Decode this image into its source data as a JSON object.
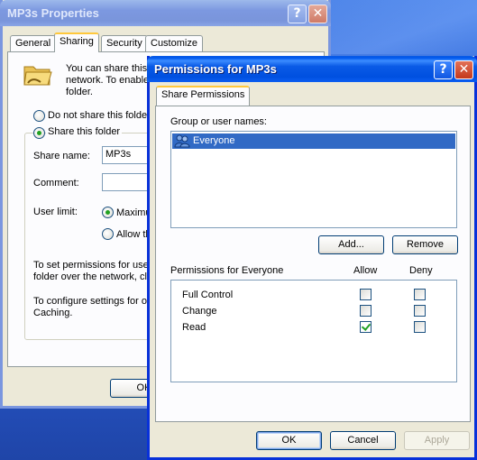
{
  "background_window": {
    "title": "MP3s Properties",
    "tabs": [
      "General",
      "Sharing",
      "Security",
      "Customize"
    ],
    "selected_tab": "Sharing",
    "intro_lines": [
      "You can share this",
      "network.  To enable",
      "folder."
    ],
    "radio_not_share": "Do not share this folder",
    "radio_share": "Share this folder",
    "share_name_label": "Share name:",
    "share_name_value": "MP3s",
    "comment_label": "Comment:",
    "comment_value": "",
    "user_limit_label": "User limit:",
    "limit_maximum": "Maximum",
    "limit_allow": "Allow th",
    "perm_text_lines": [
      "To set permissions for users",
      "folder over the network, clic"
    ],
    "config_text_lines": [
      "To configure settings for off",
      "Caching."
    ],
    "ok_label": "OK"
  },
  "dialog": {
    "title": "Permissions for MP3s",
    "tab": "Share Permissions",
    "group_label": "Group or user names:",
    "users": [
      {
        "name": "Everyone",
        "selected": true
      }
    ],
    "add_button": "Add...",
    "remove_button": "Remove",
    "permissions_header": "Permissions for Everyone",
    "allow_header": "Allow",
    "deny_header": "Deny",
    "permissions": [
      {
        "name": "Full Control",
        "allow": false,
        "deny": false
      },
      {
        "name": "Change",
        "allow": false,
        "deny": false
      },
      {
        "name": "Read",
        "allow": true,
        "deny": false
      }
    ],
    "ok_button": "OK",
    "cancel_button": "Cancel",
    "apply_button": "Apply"
  },
  "colors": {
    "selection": "#316ac5",
    "title_active": "#0058ee",
    "check_green": "#21a121"
  }
}
